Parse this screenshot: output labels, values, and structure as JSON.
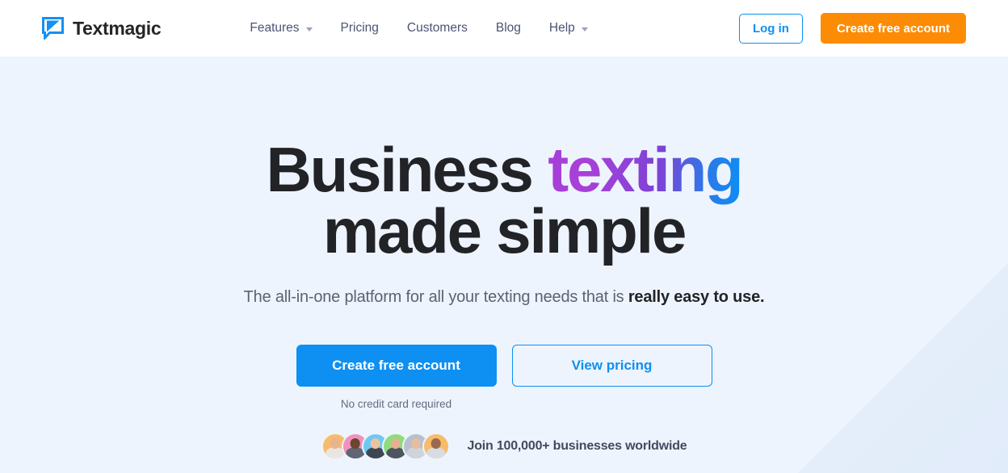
{
  "brand": {
    "name": "Textmagic",
    "logo_icon": "speech-bubble-logo-icon",
    "logo_color": "#1590f5"
  },
  "nav": {
    "items": [
      {
        "label": "Features",
        "has_dropdown": true,
        "icon": "chevron-down-icon"
      },
      {
        "label": "Pricing",
        "has_dropdown": false,
        "icon": ""
      },
      {
        "label": "Customers",
        "has_dropdown": false,
        "icon": ""
      },
      {
        "label": "Blog",
        "has_dropdown": false,
        "icon": ""
      },
      {
        "label": "Help",
        "has_dropdown": true,
        "icon": "chevron-down-icon"
      }
    ]
  },
  "header_actions": {
    "login_label": "Log in",
    "signup_label": "Create free account",
    "login_color": "#0d90f2",
    "signup_color": "#fc8c05"
  },
  "hero": {
    "headline_line1_plain": "Business ",
    "headline_line1_gradient": "texting",
    "headline_line2": "made simple",
    "gradient_from": "#a63fd9",
    "gradient_to": "#0b8ff5",
    "subtitle_plain": "The all-in-one platform for all your texting needs that is ",
    "subtitle_bold": "really easy to use.",
    "primary_cta": "Create free account",
    "secondary_cta": "View pricing",
    "note": "No credit card required",
    "primary_color": "#0d90f2",
    "social_proof_text": "Join 100,000+ businesses worldwide",
    "avatars": [
      {
        "name": "avatar-1",
        "bg": "#f7bc6a",
        "skin": "#e7b390",
        "shirt": "#e9e6e2"
      },
      {
        "name": "avatar-2",
        "bg": "#f191bd",
        "skin": "#6b4530",
        "shirt": "#5f6674"
      },
      {
        "name": "avatar-3",
        "bg": "#6ec8f2",
        "skin": "#ecc3a2",
        "shirt": "#3f4653"
      },
      {
        "name": "avatar-4",
        "bg": "#8ddd7d",
        "skin": "#e3b190",
        "shirt": "#4e5560"
      },
      {
        "name": "avatar-5",
        "bg": "#b7c0cc",
        "skin": "#e6bda0",
        "shirt": "#cfd4db"
      },
      {
        "name": "avatar-6",
        "bg": "#f7bc6a",
        "skin": "#9b6a4c",
        "shirt": "#d8dce2"
      }
    ]
  }
}
